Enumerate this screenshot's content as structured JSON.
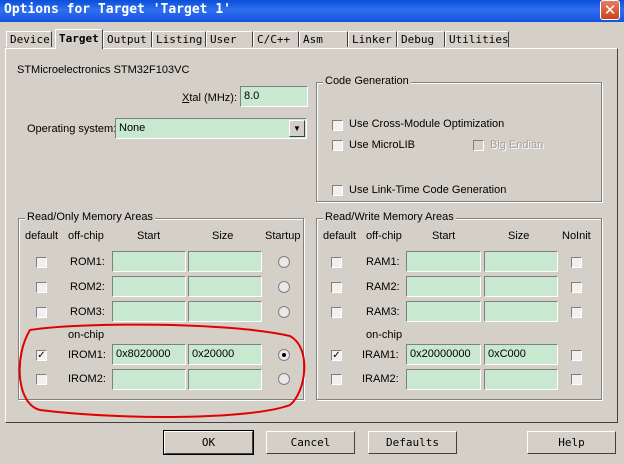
{
  "window": {
    "title": "Options for Target 'Target 1'",
    "close_symbol": "✕"
  },
  "tabs": [
    {
      "label": "Device"
    },
    {
      "label": "Target"
    },
    {
      "label": "Output"
    },
    {
      "label": "Listing"
    },
    {
      "label": "User"
    },
    {
      "label": "C/C++"
    },
    {
      "label": "Asm"
    },
    {
      "label": "Linker"
    },
    {
      "label": "Debug"
    },
    {
      "label": "Utilities"
    }
  ],
  "active_tab": "Target",
  "device_name": "STMicroelectronics STM32F103VC",
  "xtal": {
    "label_pre": "",
    "label_accel": "X",
    "label_post": "tal (MHz):",
    "value": "8.0"
  },
  "os": {
    "label": "Operating system:",
    "value": "None"
  },
  "code_generation": {
    "title": "Code Generation",
    "cross_module": "Use Cross-Module Optimization",
    "microlib": "Use MicroLIB",
    "big_endian": "Big Endian",
    "link_time": "Use Link-Time Code Generation"
  },
  "rom": {
    "title": "Read/Only Memory Areas",
    "headers": {
      "default": "default",
      "offchip": "off-chip",
      "start": "Start",
      "size": "Size",
      "startup": "Startup"
    },
    "onchip_label": "on-chip",
    "rows": [
      {
        "name": "ROM1:",
        "start": "",
        "size": "",
        "checked": false
      },
      {
        "name": "ROM2:",
        "start": "",
        "size": "",
        "checked": false
      },
      {
        "name": "ROM3:",
        "start": "",
        "size": "",
        "checked": false
      },
      {
        "name": "IROM1:",
        "start": "0x8020000",
        "size": "0x20000",
        "checked": true
      },
      {
        "name": "IROM2:",
        "start": "",
        "size": "",
        "checked": false
      }
    ]
  },
  "ram": {
    "title": "Read/Write Memory Areas",
    "headers": {
      "default": "default",
      "offchip": "off-chip",
      "start": "Start",
      "size": "Size",
      "noinit": "NoInit"
    },
    "onchip_label": "on-chip",
    "rows": [
      {
        "name": "RAM1:",
        "start": "",
        "size": "",
        "checked": false
      },
      {
        "name": "RAM2:",
        "start": "",
        "size": "",
        "checked": false
      },
      {
        "name": "RAM3:",
        "start": "",
        "size": "",
        "checked": false
      },
      {
        "name": "IRAM1:",
        "start": "0x20000000",
        "size": "0xC000",
        "checked": true
      },
      {
        "name": "IRAM2:",
        "start": "",
        "size": "",
        "checked": false
      }
    ]
  },
  "buttons": {
    "ok": "OK",
    "cancel": "Cancel",
    "defaults": "Defaults",
    "help": "Help"
  },
  "check_mark": "✓"
}
